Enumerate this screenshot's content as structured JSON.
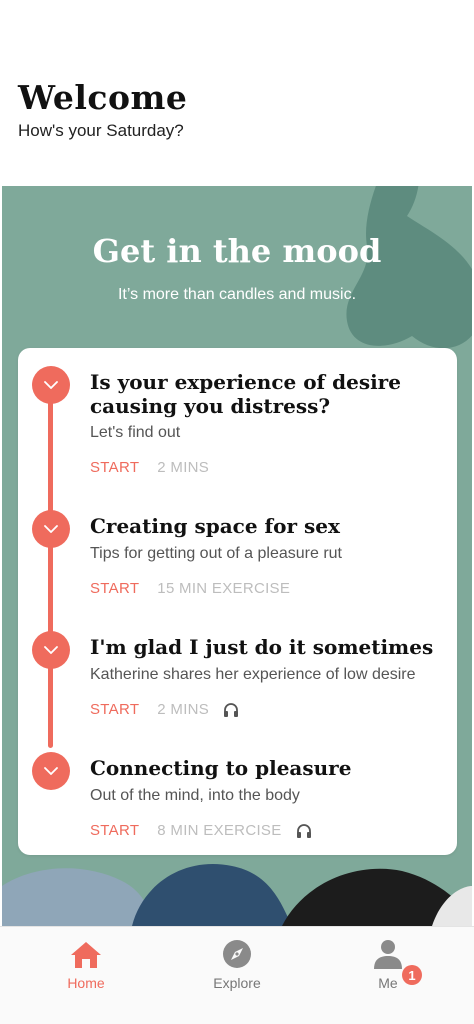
{
  "header": {
    "title": "Welcome",
    "greeting": "How's your Saturday?"
  },
  "mood": {
    "title": "Get in the mood",
    "subtitle": "It’s more than candles and music.",
    "background_color": "#7fa99a",
    "accent_color": "#ef6b5d"
  },
  "items": [
    {
      "title": "Is your experience of desire causing you distress?",
      "description": "Let's find out",
      "action": "START",
      "duration": "2 MINS",
      "audio": false
    },
    {
      "title": "Creating space for sex",
      "description": "Tips for getting out of a pleasure rut",
      "action": "START",
      "duration": "15 MIN EXERCISE",
      "audio": false
    },
    {
      "title": "I'm glad I just do it sometimes",
      "description": "Katherine shares her experience of low desire",
      "action": "START",
      "duration": "2 MINS",
      "audio": true,
      "audio_icon": "headphones-icon"
    },
    {
      "title": "Connecting to pleasure",
      "description": "Out of the mind, into the body",
      "action": "START",
      "duration": "8 MIN EXERCISE",
      "audio": true,
      "audio_icon": "headphones-icon"
    }
  ],
  "tabs": [
    {
      "label": "Home",
      "icon": "home-icon",
      "active": true
    },
    {
      "label": "Explore",
      "icon": "compass-icon",
      "active": false
    },
    {
      "label": "Me",
      "icon": "person-icon",
      "active": false,
      "badge": "1"
    }
  ]
}
